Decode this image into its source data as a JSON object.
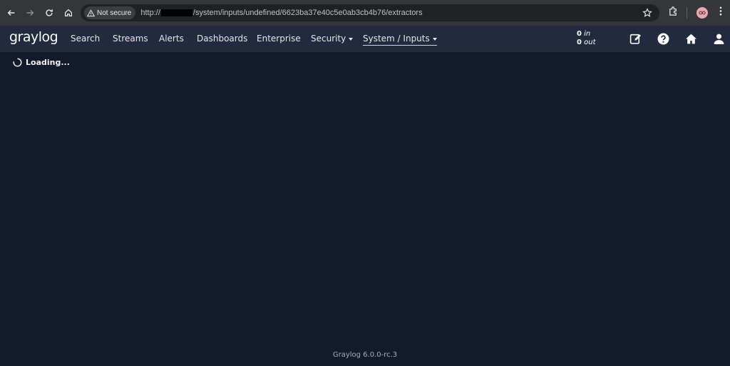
{
  "browser": {
    "security_label": "Not secure",
    "url_prefix": "http://",
    "url_suffix": "/system/inputs/undefined/6623ba37e40c5e0ab3cb4b76/extractors"
  },
  "app": {
    "logo": "graylog",
    "nav_items": [
      {
        "label": "Search"
      },
      {
        "label": "Streams"
      },
      {
        "label": "Alerts"
      },
      {
        "label": "Dashboards"
      },
      {
        "label": "Enterprise"
      },
      {
        "label": "Security"
      },
      {
        "label": "System / Inputs"
      }
    ],
    "throughput": {
      "in_value": "0",
      "in_label": "in",
      "out_value": "0",
      "out_label": "out"
    }
  },
  "content": {
    "loading_text": "Loading..."
  },
  "footer": {
    "version": "Graylog 6.0.0-rc.3"
  }
}
